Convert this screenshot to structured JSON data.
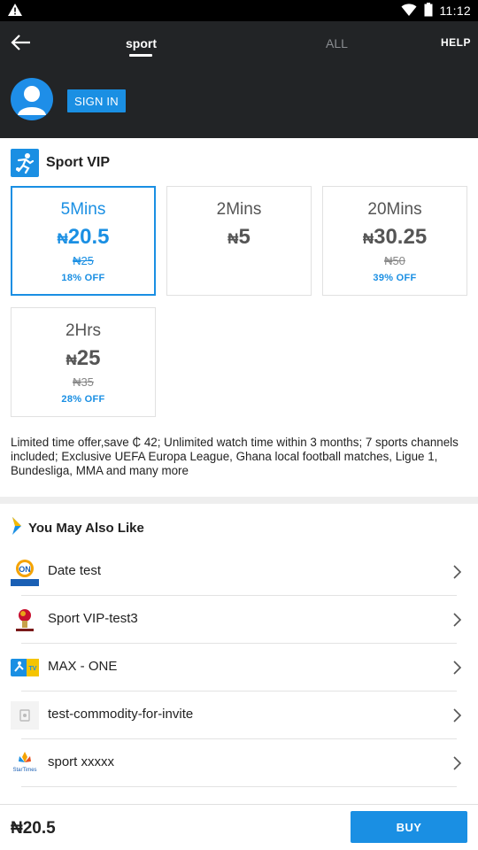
{
  "status_bar": {
    "time": "11:12"
  },
  "header": {
    "tabs": [
      {
        "label": "sport"
      },
      {
        "label": "ALL"
      }
    ],
    "help_label": "HELP",
    "signin_label": "SIGN IN"
  },
  "vip": {
    "title": "Sport VIP",
    "plans": [
      {
        "duration": "5Mins",
        "currency": "₦",
        "price": "20.5",
        "original": "₦25",
        "discount": "18% OFF",
        "selected": true
      },
      {
        "duration": "2Mins",
        "currency": "₦",
        "price": "5",
        "original": "",
        "discount": "",
        "selected": false
      },
      {
        "duration": "20Mins",
        "currency": "₦",
        "price": "30.25",
        "original": "₦50",
        "discount": "39% OFF",
        "selected": false
      },
      {
        "duration": "2Hrs",
        "currency": "₦",
        "price": "25",
        "original": "₦35",
        "discount": "28% OFF",
        "selected": false
      }
    ],
    "description": "Limited time offer,save ₵ 42; Unlimited watch time within 3 months; 7 sports channels included; Exclusive UEFA Europa League, Ghana local football matches, Ligue 1, Bundesliga, MMA and many more"
  },
  "recommendations": {
    "title": "You May Also Like",
    "items": [
      {
        "label": "Date test",
        "icon": "startimes-on-icon"
      },
      {
        "label": "Sport VIP-test3",
        "icon": "world-cup-icon"
      },
      {
        "label": "MAX - ONE",
        "icon": "max-one-icon"
      },
      {
        "label": "test-commodity-for-invite",
        "icon": "placeholder-image-icon"
      },
      {
        "label": "sport xxxxx",
        "icon": "startimes-icon"
      }
    ]
  },
  "footer": {
    "total": "₦20.5",
    "buy_label": "BUY"
  },
  "colors": {
    "accent": "#1a8fe3",
    "header_bg": "#222426"
  }
}
